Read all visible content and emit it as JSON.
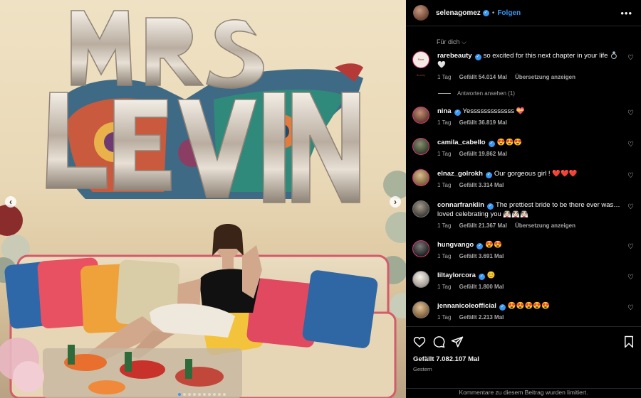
{
  "post": {
    "username": "selenagomez",
    "follow_label": "Folgen",
    "bullet": "•",
    "more_label": "•••"
  },
  "filter_label": "Für dich",
  "comments": [
    {
      "username": "rarebeauty",
      "text": "so excited for this next chapter in your life 💍🤍",
      "time": "1 Tag",
      "likes": "Gefällt 54.014 Mal",
      "translate": "Übersetzung anzeigen",
      "avatar_color": "#f4ece4",
      "avatar_label": "Rare Beauty"
    },
    {
      "username": "nina",
      "text": "Yesssssssssssss 💝",
      "time": "1 Tag",
      "likes": "Gefällt 36.819 Mal",
      "translate": "",
      "avatar_color": "#7a4a40"
    },
    {
      "username": "camila_cabello",
      "text": "😍😍😍",
      "time": "1 Tag",
      "likes": "Gefällt 19.862 Mal",
      "translate": "",
      "avatar_color": "#4b5a3f"
    },
    {
      "username": "elnaz_golrokh",
      "text": "Our gorgeous girl ! ❤️❤️❤️",
      "time": "1 Tag",
      "likes": "Gefällt 3.314 Mal",
      "translate": "",
      "avatar_color": "#b59a70"
    },
    {
      "username": "connarfranklin",
      "text": "The prettiest bride to be there ever was… loved celebrating you 👰🏻👰🏻👰🏻",
      "time": "1 Tag",
      "likes": "Gefällt 21.367 Mal",
      "translate": "Übersetzung anzeigen",
      "avatar_color": "#5f5a52"
    },
    {
      "username": "hungvango",
      "text": "😍😍",
      "time": "1 Tag",
      "likes": "Gefällt 3.691 Mal",
      "translate": "",
      "avatar_color": "#3b3b3b"
    },
    {
      "username": "liltaylorcora",
      "text": "😊",
      "time": "1 Tag",
      "likes": "Gefällt 1.800 Mal",
      "translate": "",
      "avatar_color": "#e9e6e2"
    },
    {
      "username": "jennanicoleofficial",
      "text": "😍😍😍😍😍",
      "time": "1 Tag",
      "likes": "Gefällt 2.213 Mal",
      "translate": "",
      "avatar_color": "#c4a27a"
    }
  ],
  "replies_label": "Antworten ansehen (1)",
  "footer": {
    "likes": "Gefällt 7.082.107 Mal",
    "date": "Gestern",
    "limited": "Kommentare zu diesem Beitrag wurden limitiert."
  },
  "icons": {
    "heart": "heart-icon",
    "comment": "comment-icon",
    "share": "share-icon",
    "save": "bookmark-icon",
    "verified": "verified-badge-icon"
  },
  "colors": {
    "accent": "#3897f0",
    "background": "#000000",
    "muted": "#a8a8a8"
  },
  "photo": {
    "balloon_text_top": "MRS",
    "balloon_text_bottom": "LEVIN"
  }
}
